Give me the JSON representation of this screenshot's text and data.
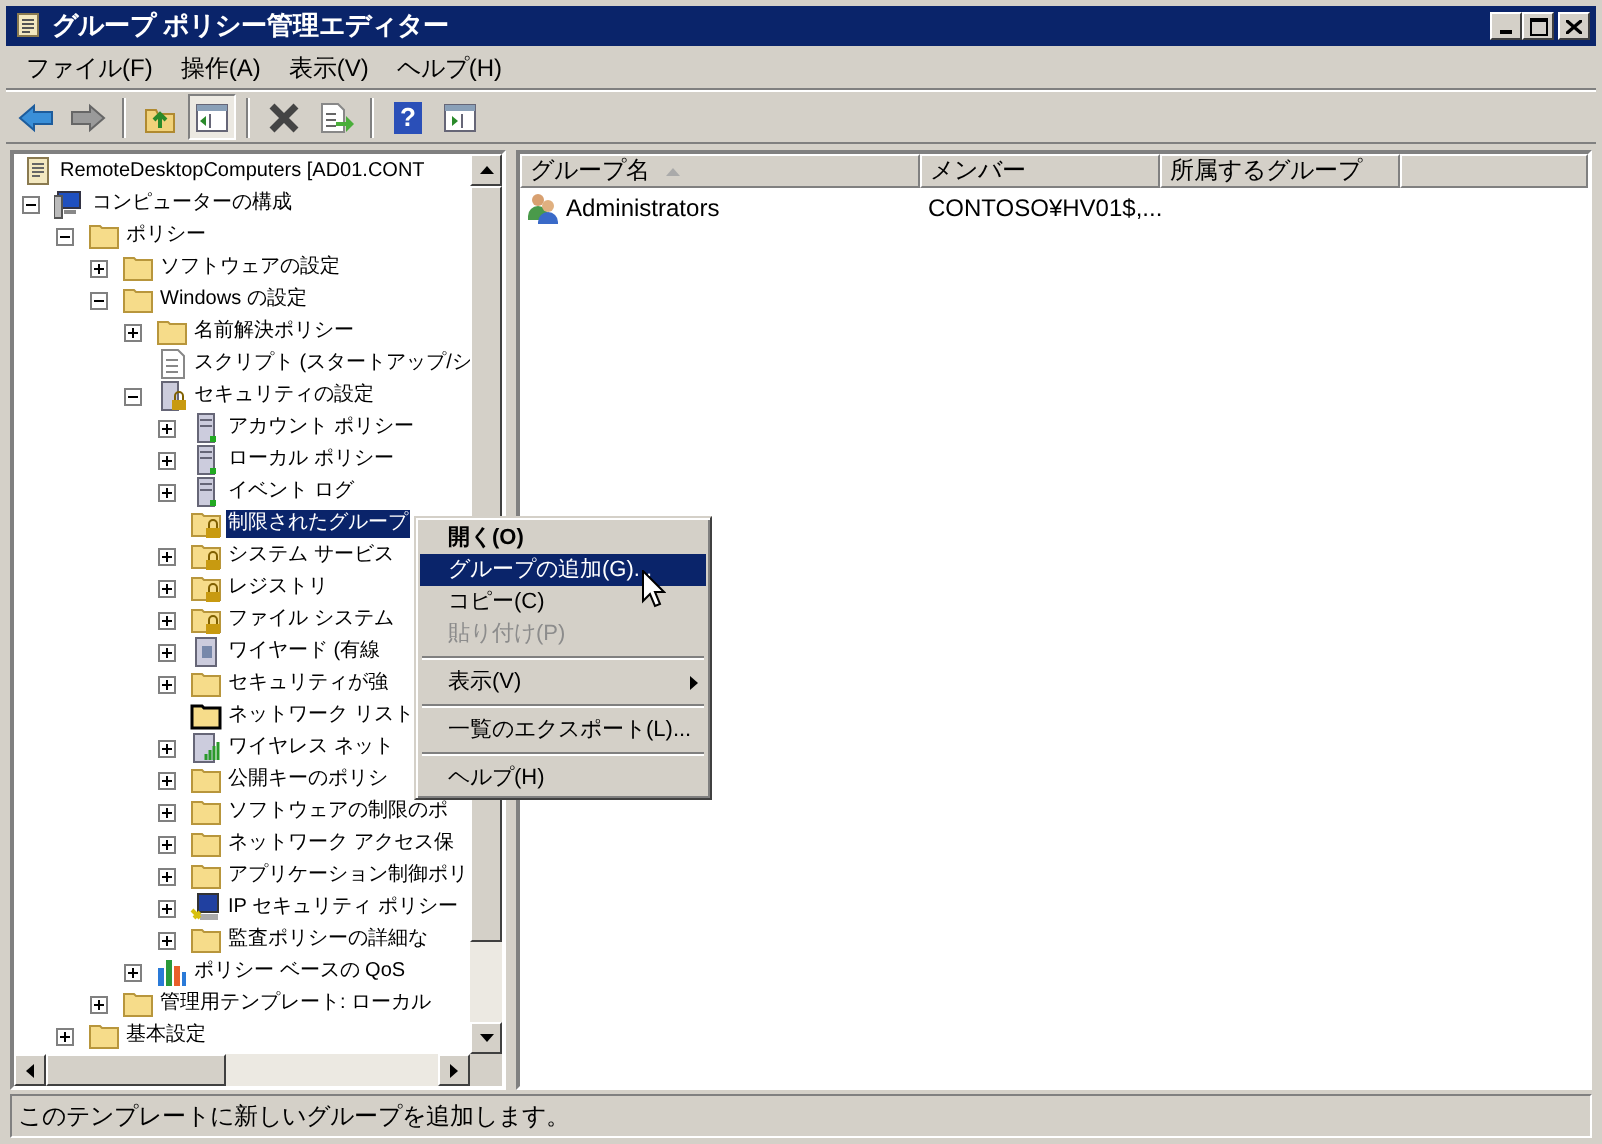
{
  "window": {
    "title": "グループ ポリシー管理エディター",
    "controls": [
      {
        "kind": "minimize"
      },
      {
        "kind": "maximize"
      },
      {
        "kind": "close"
      }
    ]
  },
  "menu_bar": [
    "ファイル(F)",
    "操作(A)",
    "表示(V)",
    "ヘルプ(H)"
  ],
  "toolbar": [
    {
      "kind": "back",
      "pressed": false
    },
    {
      "kind": "forward",
      "pressed": false
    },
    {
      "kind": "sep"
    },
    {
      "kind": "up",
      "pressed": false
    },
    {
      "kind": "tree",
      "pressed": true
    },
    {
      "kind": "sep"
    },
    {
      "kind": "delete",
      "pressed": false
    },
    {
      "kind": "export",
      "pressed": false
    },
    {
      "kind": "sep"
    },
    {
      "kind": "help",
      "label": "?",
      "pressed": false
    },
    {
      "kind": "action",
      "pressed": false
    }
  ],
  "tree": {
    "label": "RemoteDesktopComputers [AD01.CONT",
    "kind": "scroll",
    "selected": false,
    "children": [
      {
        "label": "コンピューターの構成",
        "kind": "computer",
        "expanded": true,
        "selected": false,
        "children": [
          {
            "label": "ポリシー",
            "kind": "folder",
            "expanded": true,
            "selected": false,
            "children": [
              {
                "label": "ソフトウェアの設定",
                "kind": "folder",
                "expanded": false,
                "selected": false
              },
              {
                "label": "Windows の設定",
                "kind": "folder",
                "expanded": true,
                "selected": false,
                "children": [
                  {
                    "label": "名前解決ポリシー",
                    "kind": "folder",
                    "expanded": false,
                    "selected": false
                  },
                  {
                    "label": "スクリプト (スタートアップ/シ",
                    "kind": "script",
                    "selected": false
                  },
                  {
                    "label": "セキュリティの設定",
                    "kind": "server-lock",
                    "expanded": true,
                    "selected": false,
                    "children": [
                      {
                        "label": "アカウント ポリシー",
                        "kind": "server",
                        "expanded": false,
                        "selected": false
                      },
                      {
                        "label": "ローカル ポリシー",
                        "kind": "server",
                        "expanded": false,
                        "selected": false
                      },
                      {
                        "label": "イベント ログ",
                        "kind": "server",
                        "expanded": false,
                        "selected": false
                      },
                      {
                        "label": "制限されたグループ",
                        "kind": "folder-lock",
                        "selected": true
                      },
                      {
                        "label": "システム サービス",
                        "kind": "folder-lock",
                        "expanded": false,
                        "selected": false
                      },
                      {
                        "label": "レジストリ",
                        "kind": "folder-lock",
                        "expanded": false,
                        "selected": false
                      },
                      {
                        "label": "ファイル システム",
                        "kind": "folder-lock",
                        "expanded": false,
                        "selected": false
                      },
                      {
                        "label": "ワイヤード (有線",
                        "kind": "wired",
                        "expanded": false,
                        "selected": false
                      },
                      {
                        "label": "セキュリティが強",
                        "kind": "folder",
                        "expanded": false,
                        "selected": false
                      },
                      {
                        "label": "ネットワーク リスト",
                        "kind": "folder-dark",
                        "selected": false
                      },
                      {
                        "label": "ワイヤレス ネット",
                        "kind": "wireless",
                        "expanded": false,
                        "selected": false
                      },
                      {
                        "label": "公開キーのポリシ",
                        "kind": "folder",
                        "expanded": false,
                        "selected": false
                      },
                      {
                        "label": "ソフトウェアの制限のポ",
                        "kind": "folder",
                        "expanded": false,
                        "selected": false
                      },
                      {
                        "label": "ネットワーク アクセス保",
                        "kind": "folder",
                        "expanded": false,
                        "selected": false
                      },
                      {
                        "label": "アプリケーション制御ポリ",
                        "kind": "folder",
                        "expanded": false,
                        "selected": false
                      },
                      {
                        "label": "IP セキュリティ ポリシー",
                        "kind": "ip",
                        "expanded": false,
                        "selected": false
                      },
                      {
                        "label": "監査ポリシーの詳細な",
                        "kind": "folder",
                        "expanded": false,
                        "selected": false
                      }
                    ]
                  },
                  {
                    "label": "ポリシー ベースの QoS",
                    "kind": "chart",
                    "expanded": false,
                    "selected": false
                  }
                ]
              },
              {
                "label": "管理用テンプレート: ローカル",
                "kind": "folder",
                "expanded": false,
                "selected": false
              }
            ]
          },
          {
            "label": "基本設定",
            "kind": "folder",
            "expanded": false,
            "selected": false
          }
        ]
      }
    ]
  },
  "table": {
    "columns": [
      "グループ名",
      "メンバー",
      "所属するグループ"
    ],
    "rows": [
      [
        "Administrators",
        "CONTOSO¥HV01$,..."
      ]
    ]
  },
  "context_menu": [
    {
      "kind": "item",
      "label": "開く(O)",
      "default": true,
      "selected": false,
      "disabled": false
    },
    {
      "kind": "item",
      "label": "グループの追加(G)...",
      "default": false,
      "selected": true,
      "disabled": false
    },
    {
      "kind": "item",
      "label": "コピー(C)",
      "default": false,
      "selected": false,
      "disabled": false
    },
    {
      "kind": "item",
      "label": "貼り付け(P)",
      "default": false,
      "selected": false,
      "disabled": true
    },
    {
      "kind": "sep"
    },
    {
      "kind": "submenu",
      "label": "表示(V)",
      "default": false,
      "selected": false,
      "disabled": false
    },
    {
      "kind": "sep"
    },
    {
      "kind": "item",
      "label": "一覧のエクスポート(L)...",
      "default": false,
      "selected": false,
      "disabled": false
    },
    {
      "kind": "sep"
    },
    {
      "kind": "item",
      "label": "ヘルプ(H)",
      "default": false,
      "selected": false,
      "disabled": false
    }
  ],
  "status_bar": "このテンプレートに新しいグループを追加します。"
}
